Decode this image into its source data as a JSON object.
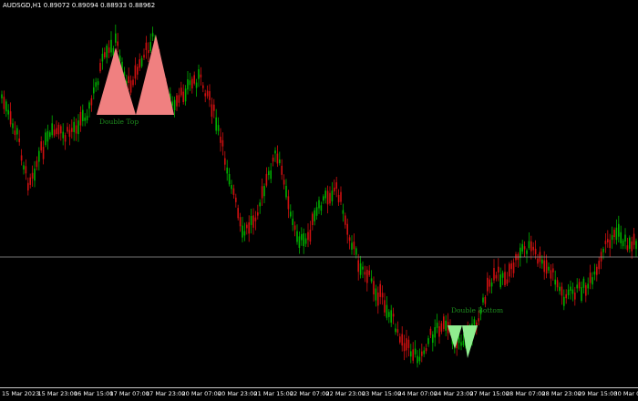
{
  "chart_header": {
    "symbol": "AUDSGD,H1",
    "ohlc": "0.89072 0.89094 0.88933 0.88962"
  },
  "colors": {
    "background": "#000000",
    "bull_candle": "#00b000",
    "bear_candle": "#d01010",
    "double_top_fill": "#f08080",
    "double_bottom_fill": "#90ee90",
    "pattern_label": "#1e8c1e",
    "bid_line": "#9a9a9a"
  },
  "patterns": {
    "double_top": {
      "label": "Double Top"
    },
    "double_bottom": {
      "label": "Double Bottom"
    }
  },
  "time_axis": {
    "labels": [
      "15 Mar 2023",
      "15 Mar 23:00",
      "16 Mar 15:00",
      "17 Mar 07:00",
      "17 Mar 23:00",
      "20 Mar 07:00",
      "20 Mar 23:00",
      "21 Mar 15:00",
      "22 Mar 07:00",
      "22 Mar 23:00",
      "23 Mar 15:00",
      "24 Mar 07:00",
      "24 Mar 23:00",
      "27 Mar 15:00",
      "28 Mar 07:00",
      "28 Mar 23:00",
      "29 Mar 15:00",
      "30 Mar 07:00"
    ]
  },
  "chart_data": {
    "type": "candlestick",
    "symbol": "AUDSGD",
    "timeframe": "H1",
    "last_bar": {
      "open": 0.89072,
      "high": 0.89094,
      "low": 0.88933,
      "close": 0.88962
    },
    "patterns": [
      "Double Top",
      "Double Bottom"
    ],
    "grid": false
  }
}
